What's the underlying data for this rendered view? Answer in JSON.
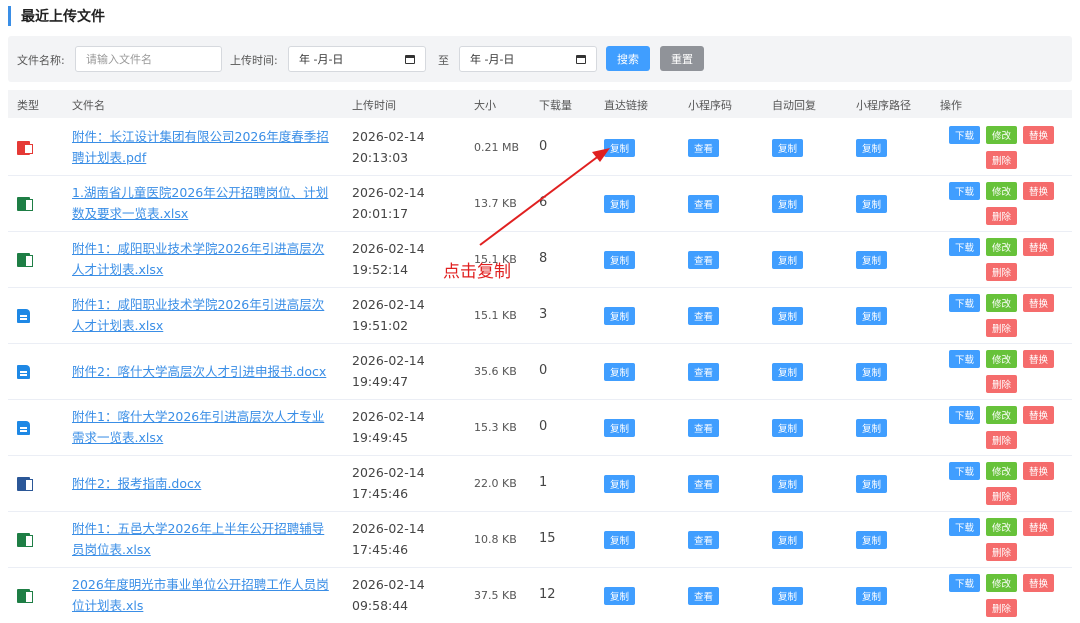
{
  "page": {
    "title": "最近上传文件"
  },
  "filter": {
    "name_label": "文件名称:",
    "name_placeholder": "请输入文件名",
    "time_label": "上传时间:",
    "date_start": "年 -月-日",
    "separator": "至",
    "date_end": "年 -月-日",
    "search_label": "搜索",
    "reset_label": "重置"
  },
  "table": {
    "headers": [
      "类型",
      "文件名",
      "上传时间",
      "大小",
      "下载量",
      "直达链接",
      "小程序码",
      "自动回复",
      "小程序路径",
      "操作"
    ],
    "copy_label": "复制",
    "view_label": "查看",
    "download_label": "下载",
    "edit_label": "修改",
    "replace_label": "替换",
    "delete_label": "删除",
    "rows": [
      {
        "icon": "pdf-icon",
        "name_l1": "附件：长江设计集团有限公司2026年度春季招",
        "name_l2": "聘计划表.pdf",
        "date": "2026-02-14",
        "time": "20:13:03",
        "size": "0.21 MB",
        "downloads": "0"
      },
      {
        "icon": "excel-icon",
        "name_l1": "1.湖南省儿童医院2026年公开招聘岗位、计划",
        "name_l2": "数及要求一览表.xlsx",
        "date": "2026-02-14",
        "time": "20:01:17",
        "size": "13.7 KB",
        "downloads": "6"
      },
      {
        "icon": "excel-icon",
        "name_l1": "附件1：咸阳职业技术学院2026年引进高层次",
        "name_l2": "人才计划表.xlsx",
        "date": "2026-02-14",
        "time": "19:52:14",
        "size": "15.1 KB",
        "downloads": "8"
      },
      {
        "icon": "file-icon",
        "name_l1": "附件1：咸阳职业技术学院2026年引进高层次",
        "name_l2": "人才计划表.xlsx",
        "date": "2026-02-14",
        "time": "19:51:02",
        "size": "15.1 KB",
        "downloads": "3"
      },
      {
        "icon": "file-icon",
        "name_l1": "附件2：喀什大学高层次人才引进申报书.docx",
        "name_l2": "",
        "date": "2026-02-14",
        "time": "19:49:47",
        "size": "35.6 KB",
        "downloads": "0"
      },
      {
        "icon": "file-icon",
        "name_l1": "附件1：喀什大学2026年引进高层次人才专业",
        "name_l2": "需求一览表.xlsx",
        "date": "2026-02-14",
        "time": "19:49:45",
        "size": "15.3 KB",
        "downloads": "0"
      },
      {
        "icon": "word-icon",
        "name_l1": "附件2：报考指南.docx",
        "name_l2": "",
        "date": "2026-02-14",
        "time": "17:45:46",
        "size": "22.0 KB",
        "downloads": "1"
      },
      {
        "icon": "excel-icon",
        "name_l1": "附件1：五邑大学2026年上半年公开招聘辅导",
        "name_l2": "员岗位表.xlsx",
        "date": "2026-02-14",
        "time": "17:45:46",
        "size": "10.8 KB",
        "downloads": "15"
      },
      {
        "icon": "excel-icon",
        "name_l1": "2026年度明光市事业单位公开招聘工作人员岗",
        "name_l2": "位计划表.xls",
        "date": "2026-02-14",
        "time": "09:58:44",
        "size": "37.5 KB",
        "downloads": "12"
      }
    ]
  },
  "annotation": {
    "text": "点击复制",
    "color": "#e02020"
  },
  "colors": {
    "accent": "#409eff",
    "success": "#67c23a",
    "danger": "#f56c6c",
    "neutral": "#909399"
  }
}
